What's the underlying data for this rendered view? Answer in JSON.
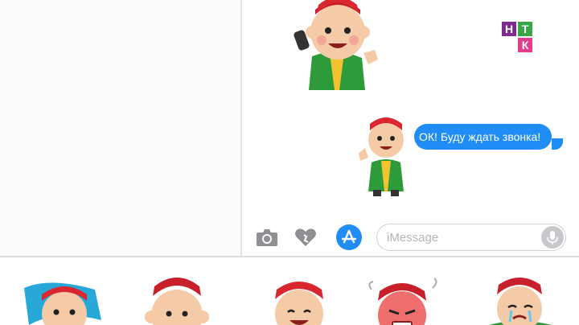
{
  "logo": {
    "letters": [
      "Н",
      "Т",
      "К"
    ]
  },
  "conversation": {
    "outgoing_message": "ОК! Буду ждать звонка!",
    "sticker_big": "boy-sticker-phone-call-icon",
    "sticker_small": "boy-sticker-thumbs-up-icon"
  },
  "input_bar": {
    "placeholder": "iMessage",
    "buttons": [
      "camera-icon",
      "digital-touch-heart-icon",
      "app-store-icon",
      "microphone-icon"
    ]
  },
  "sticker_tray": {
    "stickers": [
      "boy-with-flag-icon",
      "boy-surprised-icon",
      "boy-laughing-icon",
      "boy-angry-icon",
      "boy-crying-icon"
    ]
  },
  "colors": {
    "bubble": "#1f8df5",
    "icon_gray": "#8e8e93",
    "accent": "#1f8df5"
  }
}
